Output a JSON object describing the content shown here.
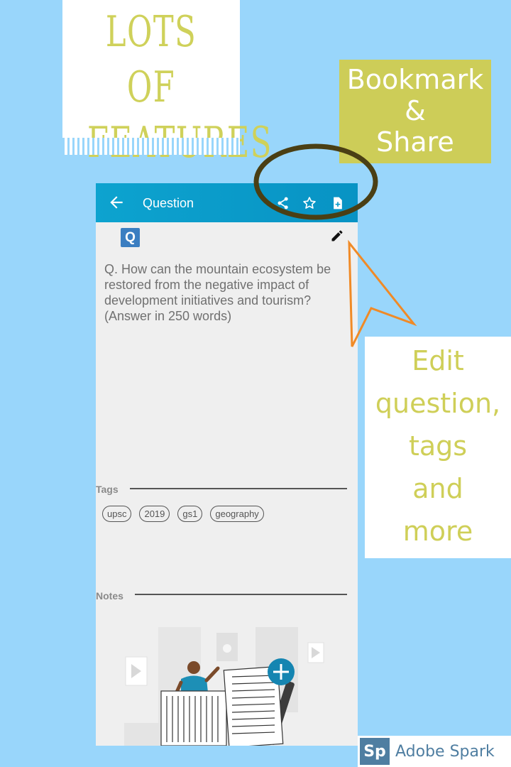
{
  "banner": {
    "title_line1": "LOTS OF",
    "title_line2": "FEATURES"
  },
  "callouts": {
    "bookmark_line1": "Bookmark",
    "bookmark_line2": "&",
    "bookmark_line3": "Share",
    "edit_line1": "Edit",
    "edit_line2": "question,",
    "edit_line3": "tags",
    "edit_line4": "and",
    "edit_line5": "more"
  },
  "appbar": {
    "title": "Question",
    "icons": [
      "back-arrow-icon",
      "share-icon",
      "star-icon",
      "add-note-icon"
    ]
  },
  "question": {
    "badge": "Q",
    "text": "Q. How can the mountain ecosystem be restored from the negative impact of development initiatives and tourism? (Answer in 250 words)"
  },
  "tags": {
    "label": "Tags",
    "items": [
      "upsc",
      "2019",
      "gs1",
      "geography"
    ]
  },
  "notes": {
    "label": "Notes"
  },
  "watermark": {
    "logo": "Sp",
    "text": "Adobe Spark"
  },
  "colors": {
    "background": "#99d6fb",
    "appbar": "#0a9bca",
    "accent_olive": "#cdcd58",
    "annotation_ring": "#4a3f14",
    "arrow": "#f08a26"
  }
}
